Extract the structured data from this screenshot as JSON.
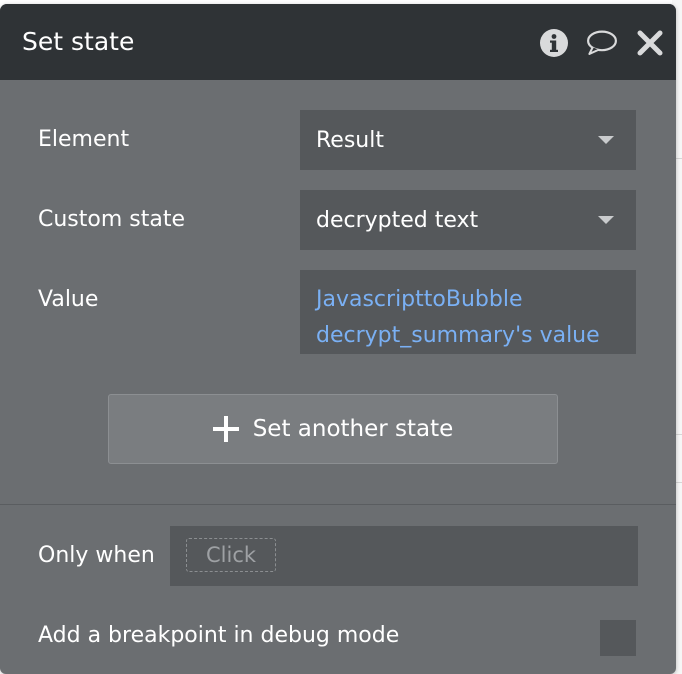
{
  "dialog": {
    "title": "Set state",
    "icons": [
      "info-icon",
      "comment-icon",
      "close-icon"
    ]
  },
  "fields": {
    "element": {
      "label": "Element",
      "value": "Result"
    },
    "custom_state": {
      "label": "Custom state",
      "value": "decrypted text"
    },
    "value": {
      "label": "Value",
      "lines": [
        "JavascripttoBubble",
        "decrypt_summary's value"
      ]
    }
  },
  "add_button": {
    "label": "Set another state",
    "icon": "plus-icon"
  },
  "condition": {
    "label": "Only when",
    "placeholder": "Click"
  },
  "breakpoint": {
    "label": "Add a breakpoint in debug mode",
    "checked": false
  },
  "colors": {
    "panel": "#6b6e71",
    "titlebar": "#2f3336",
    "field": "#55585b",
    "link_text": "#7ab0f4"
  }
}
